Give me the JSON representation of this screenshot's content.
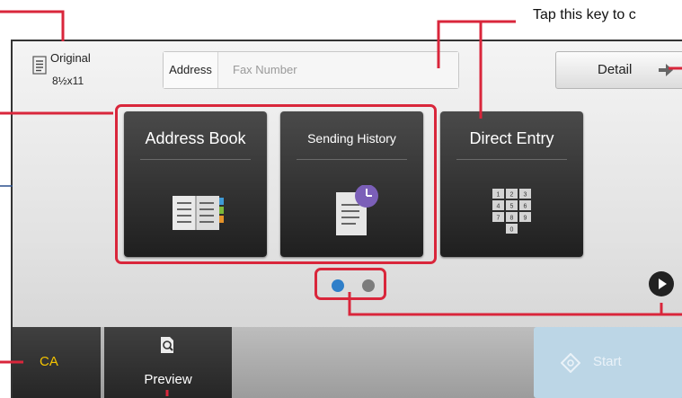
{
  "original": {
    "label": "Original",
    "size": "8½x11",
    "icon": "original-document-icon"
  },
  "address": {
    "label": "Address",
    "placeholder": "Fax Number"
  },
  "detail": {
    "label": "Detail",
    "icon": "arrow-right-icon"
  },
  "tiles": [
    {
      "label": "Address Book",
      "icon": "address-book-icon"
    },
    {
      "label": "Sending History",
      "icon": "sending-history-icon"
    },
    {
      "label": "Direct Entry",
      "icon": "keypad-icon"
    }
  ],
  "keypad_keys": [
    "1",
    "2",
    "3",
    "4",
    "5",
    "6",
    "7",
    "8",
    "9",
    "0"
  ],
  "pager": {
    "pages": 2,
    "current": 1,
    "next_icon": "play-arrow-icon"
  },
  "bottom": {
    "ca_label": "CA",
    "preview_label": "Preview",
    "preview_icon": "magnifier-document-icon",
    "start_label": "Start",
    "start_icon": "diamond-start-icon"
  },
  "callout": {
    "text": "Tap this key to c"
  },
  "colors": {
    "callout_red": "#d9263b",
    "dot_active": "#2f7fc9",
    "ca_text": "#f5c400",
    "start_disabled": "#bcd6e6"
  }
}
